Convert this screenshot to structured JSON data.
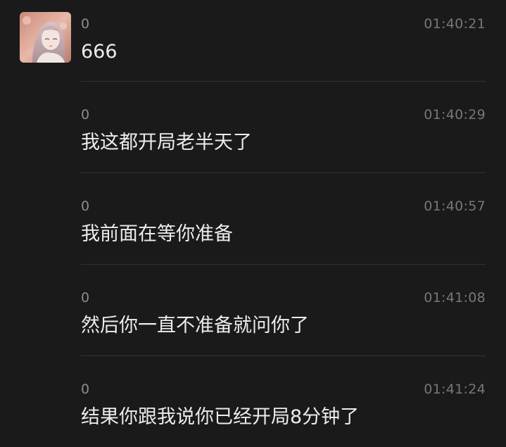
{
  "messages": [
    {
      "sender": "0",
      "time": "01:40:21",
      "text": "666",
      "has_avatar": true
    },
    {
      "sender": "0",
      "time": "01:40:29",
      "text": "我这都开局老半天了"
    },
    {
      "sender": "0",
      "time": "01:40:57",
      "text": "我前面在等你准备"
    },
    {
      "sender": "0",
      "time": "01:41:08",
      "text": "然后你一直不准备就问你了"
    },
    {
      "sender": "0",
      "time": "01:41:24",
      "text": "结果你跟我说你已经开局8分钟了"
    }
  ],
  "colors": {
    "background": "#1a1a1a",
    "message_text": "#ececec",
    "meta_text": "#8c8c8c",
    "divider": "#333333"
  }
}
